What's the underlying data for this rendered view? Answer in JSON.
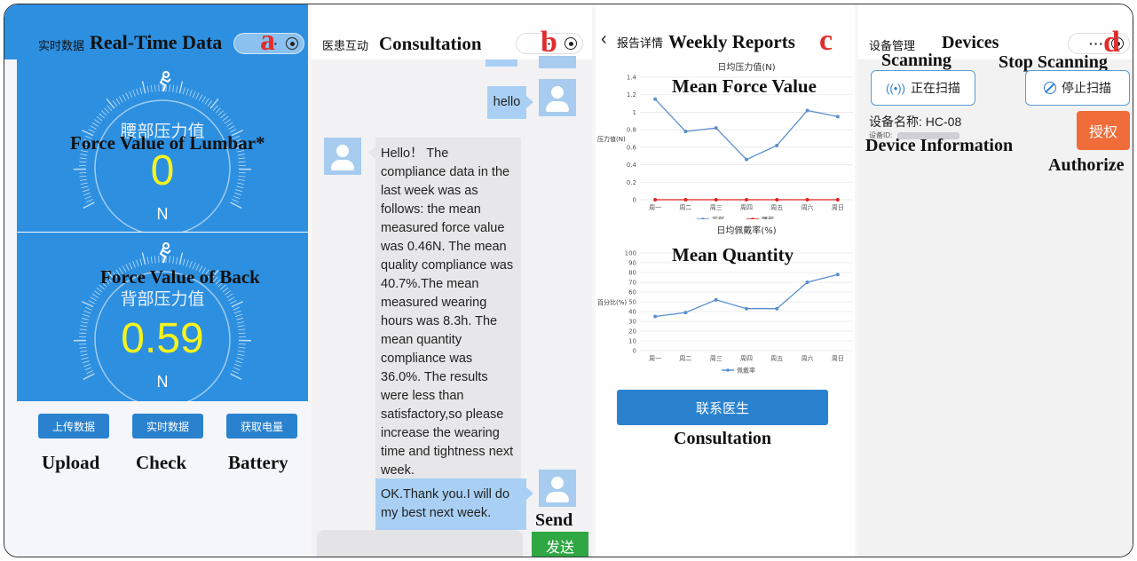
{
  "panel_a": {
    "letter": "a",
    "header_title": "实时数据",
    "annotation_title": "Real-Time Data",
    "lumbar": {
      "label": "腰部压力值",
      "annotation": "Force Value of Lumbar*",
      "value": "0",
      "unit": "N",
      "gauge_fraction": 0.0
    },
    "back": {
      "label": "背部压力值",
      "annotation": "Force Value of Back",
      "value": "0.59",
      "unit": "N",
      "gauge_fraction": 0.0
    },
    "buttons": [
      {
        "label": "上传数据",
        "annotation": "Upload"
      },
      {
        "label": "实时数据",
        "annotation": "Check"
      },
      {
        "label": "获取电量",
        "annotation": "Battery"
      }
    ],
    "colors": {
      "panel": "#2d8fe0",
      "value": "#f5f31e"
    }
  },
  "panel_b": {
    "letter": "b",
    "header_title": "医患互动",
    "annotation_title": "Consultation",
    "messages": [
      {
        "from": "patient",
        "text": "hello"
      },
      {
        "from": "doctor",
        "text": "Hello！ The compliance data in the last week was as follows: the mean measured force value was 0.46N. The mean quality compliance was 40.7%.The mean measured wearing hours was 8.3h. The mean quantity compliance was 36.0%. The results were less than satisfactory,so please increase the wearing time and tightness next week."
      },
      {
        "from": "patient",
        "text": "OK.Thank you.I will do my best next week."
      }
    ],
    "send_label": "发送",
    "send_annotation": "Send",
    "colors": {
      "send": "#2fa743",
      "patient_bubble": "#a9d0f4",
      "doctor_bubble": "#e7e7e9"
    }
  },
  "panel_c": {
    "letter": "c",
    "back_glyph": "‹",
    "header_title": "报告详情",
    "annotation_title": "Weekly Reports",
    "force_annotation": "Mean Force Value",
    "quantity_annotation": "Mean Quantity",
    "button_label": "联系医生",
    "button_annotation": "Consultation"
  },
  "chart_data": [
    {
      "type": "line",
      "title": "日均压力值(N)",
      "ylabel": "压力值(N)",
      "xlabel": "",
      "categories": [
        "周一",
        "周二",
        "周三",
        "周四",
        "周五",
        "周六",
        "周日"
      ],
      "ylim": [
        0,
        1.4
      ],
      "yticks": [
        0,
        0.2,
        0.4,
        0.6,
        0.8,
        1,
        1.2,
        1.4
      ],
      "legend": "bottom",
      "series": [
        {
          "name": "背部",
          "color": "#5b8fd0",
          "values": [
            1.15,
            0.78,
            0.82,
            0.46,
            0.62,
            1.02,
            0.95
          ]
        },
        {
          "name": "腰部",
          "color": "#e02020",
          "values": [
            0,
            0,
            0,
            0,
            0,
            0,
            0
          ]
        }
      ]
    },
    {
      "type": "line",
      "title": "日均佩戴率(%)",
      "ylabel": "百分比(%)",
      "xlabel": "",
      "categories": [
        "周一",
        "周二",
        "周三",
        "周四",
        "周五",
        "周六",
        "周日"
      ],
      "ylim": [
        0,
        100
      ],
      "yticks": [
        0,
        10,
        20,
        30,
        40,
        50,
        60,
        70,
        80,
        90,
        100
      ],
      "legend": "bottom",
      "series": [
        {
          "name": "佩戴率",
          "color": "#5b8fd0",
          "values": [
            35,
            39,
            52,
            43,
            43,
            70,
            78
          ]
        }
      ]
    }
  ],
  "panel_d": {
    "letter": "d",
    "header_title": "设备管理",
    "annotation_title": "Devices",
    "scanning_annotation": "Scanning",
    "scanning_label": "正在扫描",
    "stop_annotation": "Stop Scanning",
    "stop_label": "停止扫描",
    "device_name": "设备名称: HC-08",
    "device_id_label": "设备ID:",
    "device_info_annotation": "Device Information",
    "authorize_label": "授权",
    "authorize_annotation": "Authorize",
    "colors": {
      "authorize": "#f06d3a"
    }
  }
}
